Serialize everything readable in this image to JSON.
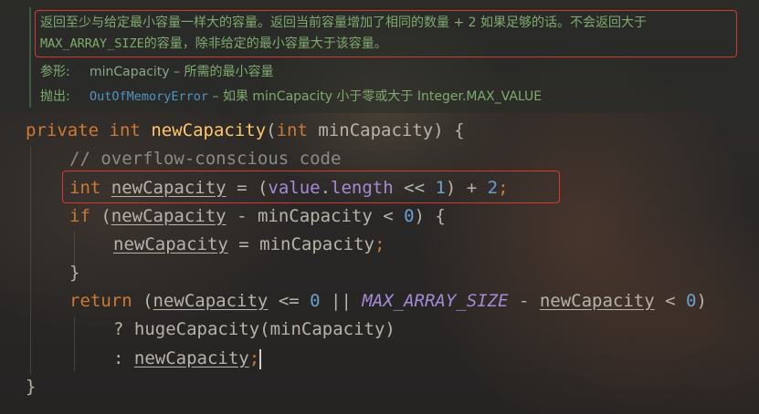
{
  "doc": {
    "description_line1": "返回至少与给定最小容量一样大的容量。返回当前容量增加了相同的数量 + 2 如果足够的话。不会返回大于",
    "description_line2_code": "MAX_ARRAY_SIZE",
    "description_line2_rest": "的容量，除非给定的最小容量大于该容量。",
    "param_label": "参形:",
    "param_name": "minCapacity",
    "param_desc": " – 所需的最小容量",
    "throws_label": "抛出:",
    "throws_type": "OutOfMemoryError",
    "throws_desc": " – 如果 minCapacity 小于零或大于 Integer.MAX_VALUE"
  },
  "code": {
    "l1_kw1": "private",
    "l1_kw2": "int",
    "l1_method": "newCapacity",
    "l1_open": "(",
    "l1_kw3": "int",
    "l1_param": " minCapacity) {",
    "l2_comment": "// overflow-conscious code",
    "l3_kw": "int",
    "l3_var": "newCapacity",
    "l3_eq": " = (",
    "l3_field": "value",
    "l3_dot": ".",
    "l3_len": "length",
    "l3_shift": " << ",
    "l3_n1": "1",
    "l3_plus": ") + ",
    "l3_n2": "2",
    "l3_semi": ";",
    "l4_kw": "if",
    "l4_open": " (",
    "l4_var": "newCapacity",
    "l4_mid": " - minCapacity < ",
    "l4_zero": "0",
    "l4_close": ") {",
    "l5_var": "newCapacity",
    "l5_rest": " = minCapacity",
    "l5_semi": ";",
    "l6_brace": "}",
    "l7_kw": "return",
    "l7_open": " (",
    "l7_var1": "newCapacity",
    "l7_mid1": " <= ",
    "l7_zero1": "0",
    "l7_or": " || ",
    "l7_const": "MAX_ARRAY_SIZE",
    "l7_minus": " - ",
    "l7_var2": "newCapacity",
    "l7_lt": " < ",
    "l7_zero2": "0",
    "l7_close": ")",
    "l8_text": "? hugeCapacity(minCapacity)",
    "l9_colon": ": ",
    "l9_var": "newCapacity",
    "l9_semi": ";",
    "l10_brace": "}"
  },
  "colors": {
    "keyword": "#cc7a33",
    "method": "#ffc66d",
    "comment": "#8a8a87",
    "number": "#6aa0d0",
    "field": "#a58ad5",
    "doc_text": "#7faa6e",
    "doc_link": "#4f93bf",
    "highlight_box": "#d43a32"
  }
}
